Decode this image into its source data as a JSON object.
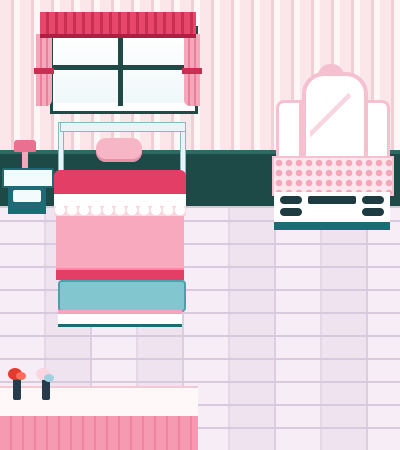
{
  "scene": {
    "room": "pink bedroom",
    "items": [
      "window",
      "curtains",
      "nightstand",
      "lamp",
      "bed",
      "pillow",
      "vanity",
      "mirror",
      "table",
      "flowers"
    ]
  },
  "colors": {
    "wall": "#fbe7ea",
    "wainscot": "#1d4a46",
    "floor": "#efe3ef",
    "bed_red": "#e23e66",
    "bed_pink": "#f8a9bd",
    "teal": "#1f6b75",
    "light_blue": "#82c6d0"
  }
}
